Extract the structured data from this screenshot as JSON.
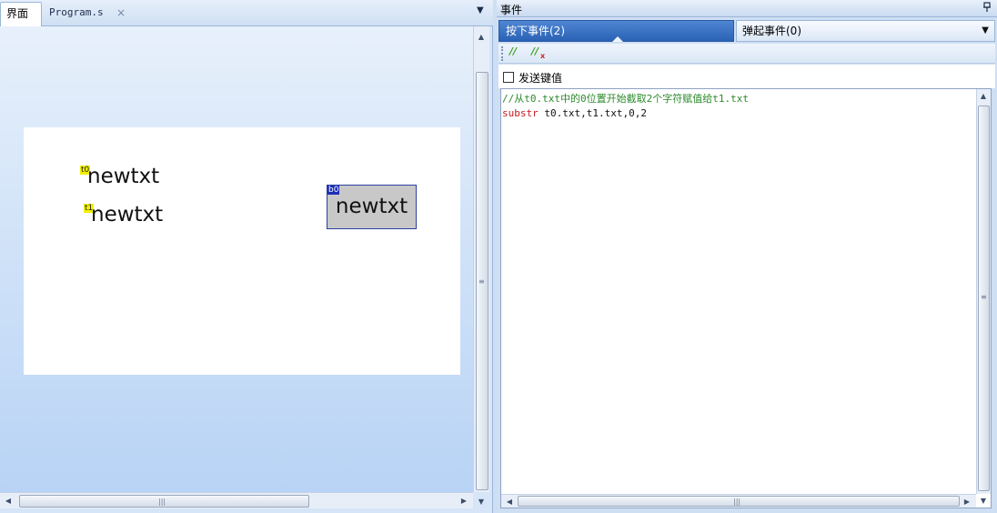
{
  "left": {
    "tabs": [
      {
        "label": "界面"
      },
      {
        "label": "Program.s"
      }
    ],
    "close_glyph": "×",
    "menu_glyph": "▼",
    "canvas": {
      "components": [
        {
          "id": "t0",
          "text": "newtxt"
        },
        {
          "id": "t1",
          "text": "newtxt"
        },
        {
          "id": "b0",
          "text": "newtxt"
        }
      ]
    }
  },
  "right": {
    "panel_title": "事件",
    "pin_glyph": "ᵖ",
    "event_tabs": [
      {
        "label": "按下事件(2)",
        "selected": true
      },
      {
        "label": "弹起事件(0)",
        "selected": false
      }
    ],
    "dropdown_glyph": "▼",
    "toolbar": {
      "comment_glyph": "//",
      "uncomment_glyph": "//",
      "uncomment_mark": "x"
    },
    "send_key_label": "发送键值",
    "send_key_checked": false,
    "code": {
      "comment_line": "//从t0.txt中的0位置开始截取2个字符赋值给t1.txt",
      "keyword": "substr",
      "args": " t0.txt,t1.txt,0,2"
    }
  },
  "scroll_glyphs": {
    "up": "▲",
    "down": "▼",
    "left": "◀",
    "right": "▶",
    "grip_v": "≡",
    "grip_h": "|||"
  },
  "colors": {
    "selected_tab": "#2a62b5",
    "tag_yellow": "#f0f000",
    "tag_blue": "#1b2fb5",
    "comment_green": "#2b8a2b",
    "keyword_red": "#c8181e"
  }
}
